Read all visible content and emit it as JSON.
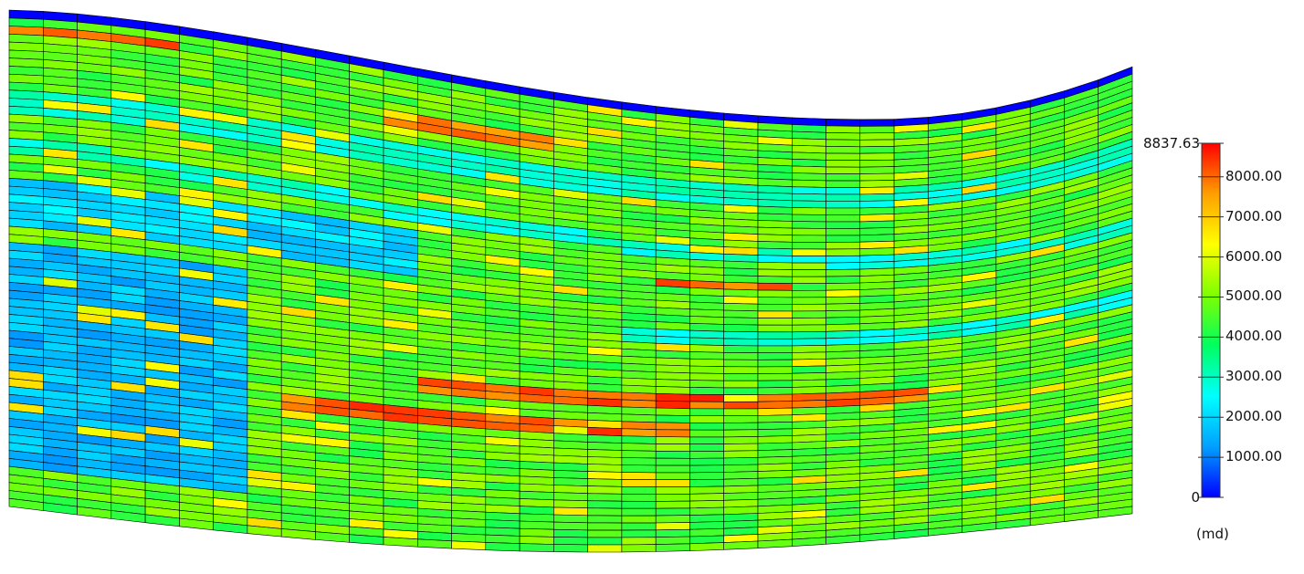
{
  "chart_data": {
    "type": "heatmap",
    "title": "",
    "xlabel": "",
    "ylabel": "",
    "colorbar": {
      "min_label": "0",
      "max_label": "8837.63",
      "unit": "(md)",
      "ticks": [
        {
          "value": 1000,
          "label": "1000.00"
        },
        {
          "value": 2000,
          "label": "2000.00"
        },
        {
          "value": 3000,
          "label": "3000.00"
        },
        {
          "value": 4000,
          "label": "4000.00"
        },
        {
          "value": 5000,
          "label": "5000.00"
        },
        {
          "value": 6000,
          "label": "6000.00"
        },
        {
          "value": 7000,
          "label": "7000.00"
        },
        {
          "value": 8000,
          "label": "8000.00"
        }
      ],
      "range": [
        0,
        8837.63
      ],
      "colors": [
        "#0000ff",
        "#00a0ff",
        "#00ffff",
        "#00ff60",
        "#7fff00",
        "#ffff00",
        "#ff9f00",
        "#ff0000"
      ]
    },
    "grid": {
      "columns": 33,
      "layers": 62,
      "top_layer_value": 0,
      "cell_outline": "#000000"
    }
  }
}
